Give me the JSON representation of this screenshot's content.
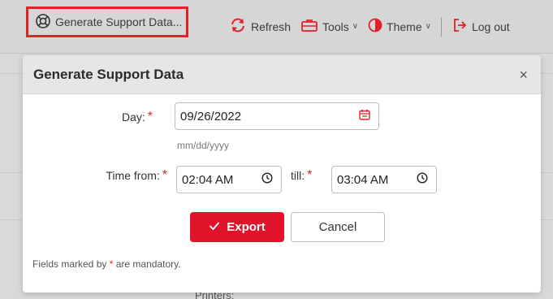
{
  "toolbar": {
    "generate_label": "Generate Support Data...",
    "refresh_label": "Refresh",
    "tools_label": "Tools",
    "theme_label": "Theme",
    "logout_label": "Log out"
  },
  "background": {
    "partial_text": "Printers:"
  },
  "dialog": {
    "title": "Generate Support Data",
    "close_symbol": "×",
    "day_label": "Day:",
    "required_mark": "*",
    "day_value": "09/26/2022",
    "day_hint": "mm/dd/yyyy",
    "time_from_label": "Time from:",
    "time_from_value": "02:04 AM",
    "till_label": "till:",
    "till_value": "03:04 AM",
    "export_label": "Export",
    "cancel_label": "Cancel",
    "footnote_prefix": "Fields marked by",
    "footnote_suffix": "are mandatory."
  },
  "colors": {
    "accent": "#e0132b",
    "highlight_border": "#e3202a"
  }
}
